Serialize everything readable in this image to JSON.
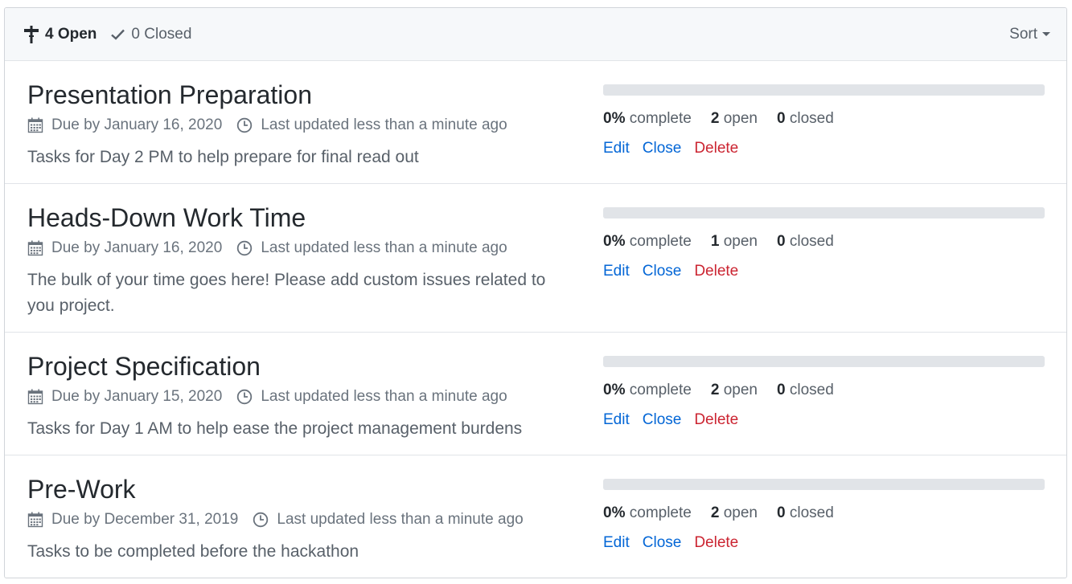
{
  "header": {
    "open_label": "4 Open",
    "closed_label": "0 Closed",
    "sort_label": "Sort"
  },
  "colors": {
    "link": "#0366d6",
    "danger": "#cb2431",
    "progress_track": "#e1e4e8"
  },
  "milestones": [
    {
      "title": "Presentation Preparation",
      "due": "Due by January 16, 2020",
      "updated": "Last updated less than a minute ago",
      "description": "Tasks for Day 2 PM to help prepare for final read out",
      "progress": 0,
      "percent": "0%",
      "percent_label": "complete",
      "open_count": "2",
      "open_label": "open",
      "closed_count": "0",
      "closed_label": "closed",
      "edit": "Edit",
      "close": "Close",
      "delete": "Delete"
    },
    {
      "title": "Heads-Down Work Time",
      "due": "Due by January 16, 2020",
      "updated": "Last updated less than a minute ago",
      "description": "The bulk of your time goes here! Please add custom issues related to you project.",
      "progress": 0,
      "percent": "0%",
      "percent_label": "complete",
      "open_count": "1",
      "open_label": "open",
      "closed_count": "0",
      "closed_label": "closed",
      "edit": "Edit",
      "close": "Close",
      "delete": "Delete"
    },
    {
      "title": "Project Specification",
      "due": "Due by January 15, 2020",
      "updated": "Last updated less than a minute ago",
      "description": "Tasks for Day 1 AM to help ease the project management burdens",
      "progress": 0,
      "percent": "0%",
      "percent_label": "complete",
      "open_count": "2",
      "open_label": "open",
      "closed_count": "0",
      "closed_label": "closed",
      "edit": "Edit",
      "close": "Close",
      "delete": "Delete"
    },
    {
      "title": "Pre-Work",
      "due": "Due by December 31, 2019",
      "updated": "Last updated less than a minute ago",
      "description": "Tasks to be completed before the hackathon",
      "progress": 0,
      "percent": "0%",
      "percent_label": "complete",
      "open_count": "2",
      "open_label": "open",
      "closed_count": "0",
      "closed_label": "closed",
      "edit": "Edit",
      "close": "Close",
      "delete": "Delete"
    }
  ]
}
